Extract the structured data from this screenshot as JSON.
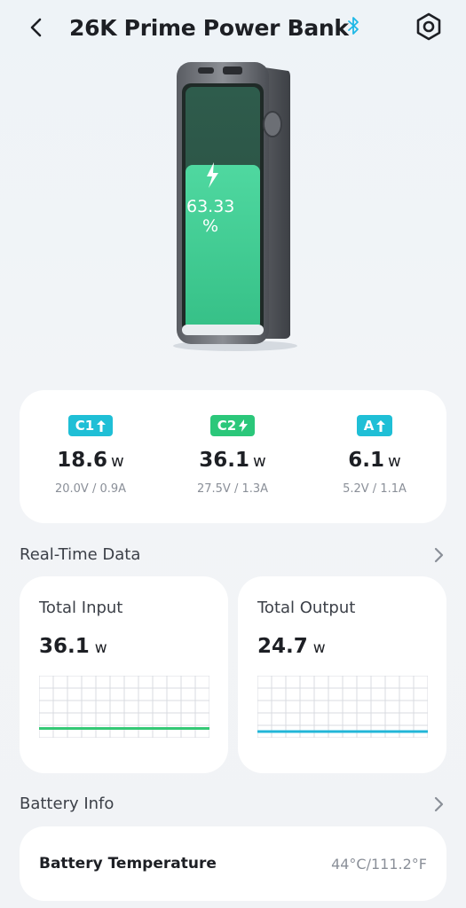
{
  "header": {
    "title": "26K Prime Power Bank",
    "back_icon": "chevron-left-icon",
    "bluetooth_icon": "bluetooth-icon",
    "settings_icon": "hex-settings-icon"
  },
  "device": {
    "charge_percent": 63.33,
    "charge_value": "63.33",
    "charge_unit": "%",
    "fill_color": "#3fcf96"
  },
  "ports": [
    {
      "name": "C1",
      "direction_icon": "arrow-up-icon",
      "color": "#1fbfd6",
      "power": "18.6",
      "unit": "w",
      "detail": "20.0V / 0.9A"
    },
    {
      "name": "C2",
      "direction_icon": "bolt-icon",
      "color": "#2bc77a",
      "power": "36.1",
      "unit": "w",
      "detail": "27.5V / 1.3A"
    },
    {
      "name": "A",
      "direction_icon": "arrow-up-icon",
      "color": "#1fbfd6",
      "power": "6.1",
      "unit": "w",
      "detail": "5.2V / 1.1A"
    }
  ],
  "realtime": {
    "title": "Real-Time Data",
    "input": {
      "label": "Total Input",
      "value": "36.1",
      "unit": "w",
      "line_color": "#35c976",
      "level": 0.15
    },
    "output": {
      "label": "Total Output",
      "value": "24.7",
      "unit": "w",
      "line_color": "#22b6d8",
      "level": 0.1
    }
  },
  "battery_info": {
    "title": "Battery Info",
    "temperature_label": "Battery Temperature",
    "temperature_value": "44°C/111.2°F"
  },
  "colors": {
    "accent_cyan": "#1fbfd6",
    "accent_green": "#2bc77a",
    "card_bg": "#ffffff"
  }
}
